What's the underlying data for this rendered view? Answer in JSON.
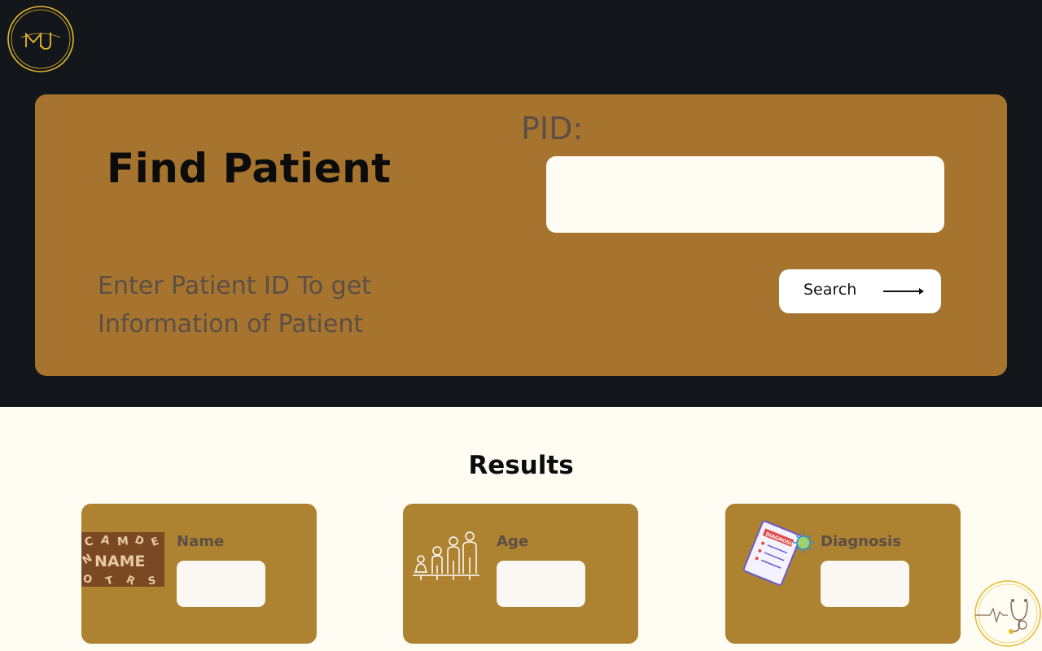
{
  "header": {
    "logo_text": "MJ",
    "logo_icon": "mj-monogram-logo"
  },
  "find_panel": {
    "title": "Find Patient",
    "pid_label": "PID:",
    "pid_value": "",
    "pid_placeholder": "",
    "hint": "Enter Patient ID To get Information of Patient",
    "search_label": "Search",
    "search_icon": "arrow-right-icon"
  },
  "results": {
    "title": "Results",
    "cards": [
      {
        "label": "Name",
        "value": "",
        "icon": "name-letters-image"
      },
      {
        "label": "Age",
        "value": "",
        "icon": "age-growth-figures-image"
      },
      {
        "label": "Diagnosis",
        "value": "",
        "icon": "diagnosis-report-image"
      }
    ]
  },
  "footer_badge": {
    "icon": "stethoscope-heartbeat-badge"
  },
  "colors": {
    "header_bg": "#13171b",
    "panel_bg": "#a6742e",
    "card_bg": "#ad8230",
    "page_bg": "#fffdf3",
    "gold_accent": "#e7b92c",
    "muted_text": "#5b4f46"
  }
}
